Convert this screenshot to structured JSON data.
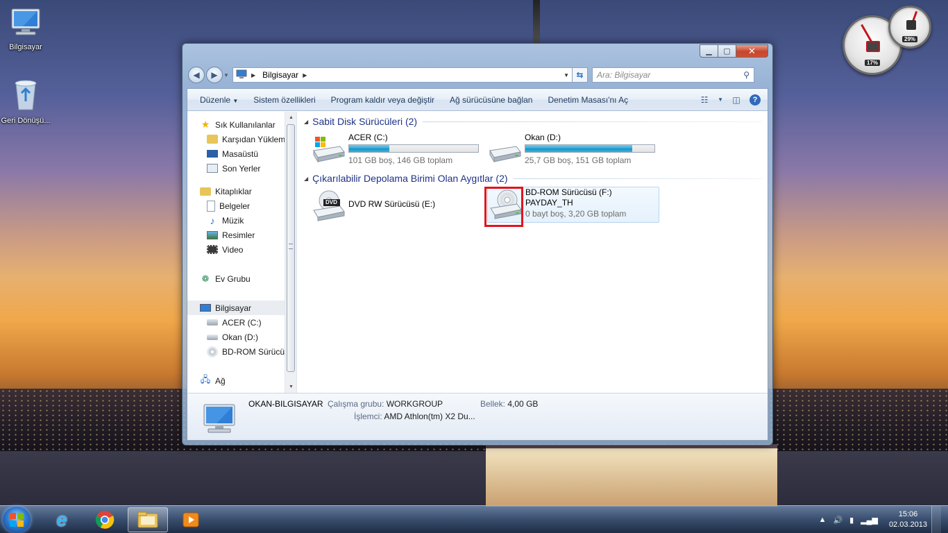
{
  "desktop": {
    "icons": [
      {
        "label": "Bilgisayar",
        "icon": "computer-icon"
      },
      {
        "label": "Geri Dönüşü...",
        "icon": "recycle-bin-icon"
      }
    ]
  },
  "gadget": {
    "cpu_percent": "17%",
    "ram_percent": "29%"
  },
  "window": {
    "address": {
      "crumb": "Bilgisayar"
    },
    "search": {
      "placeholder": "Ara: Bilgisayar"
    },
    "toolbar": {
      "organize": "Düzenle",
      "system_properties": "Sistem özellikleri",
      "uninstall": "Program kaldır veya değiştir",
      "map_drive": "Ağ sürücüsüne bağlan",
      "control_panel": "Denetim Masası'nı Aç"
    },
    "nav": {
      "favorites": "Sık Kullanılanlar",
      "downloads": "Karşıdan Yüklem",
      "desktop": "Masaüstü",
      "recent": "Son Yerler",
      "libraries": "Kitaplıklar",
      "documents": "Belgeler",
      "music": "Müzik",
      "pictures": "Resimler",
      "video": "Video",
      "homegroup": "Ev Grubu",
      "computer": "Bilgisayar",
      "acer": "ACER (C:)",
      "okan": "Okan (D:)",
      "bdrom": "BD-ROM Sürücüsü",
      "network": "Ağ"
    },
    "groups": {
      "hard_disks": "Sabit Disk Sürücüleri (2)",
      "removable": "Çıkarılabilir Depolama Birimi Olan Aygıtlar (2)"
    },
    "drives": {
      "c": {
        "name": "ACER (C:)",
        "free": "101 GB boş, 146 GB toplam",
        "used_fraction": 0.31
      },
      "d": {
        "name": "Okan (D:)",
        "free": "25,7 GB boş, 151 GB toplam",
        "used_fraction": 0.83
      },
      "e": {
        "name": "DVD RW Sürücüsü (E:)",
        "badge": "DVD"
      },
      "f": {
        "name": "BD-ROM Sürücüsü (F:)",
        "label": "PAYDAY_TH",
        "free": "0 bayt boş, 3,20 GB toplam"
      }
    },
    "details": {
      "computer_name": "OKAN-BILGISAYAR",
      "workgroup_label": "Çalışma grubu:",
      "workgroup": "WORKGROUP",
      "memory_label": "Bellek:",
      "memory": "4,00 GB",
      "cpu_label": "İşlemci:",
      "cpu": "AMD Athlon(tm) X2 Du..."
    }
  },
  "taskbar": {
    "clock_time": "15:06",
    "clock_date": "02.03.2013"
  },
  "colors": {
    "highlight_box": "#e0141e",
    "group_header": "#1e3287",
    "bar_fill": "#2ba6d6"
  }
}
